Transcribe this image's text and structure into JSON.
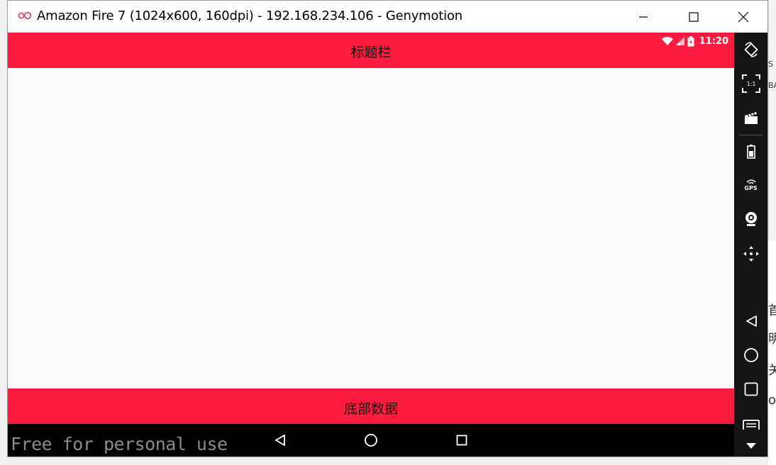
{
  "window": {
    "title": "Amazon Fire 7 (1024x600, 160dpi) - 192.168.234.106 - Genymotion"
  },
  "status_bar": {
    "time": "11:20"
  },
  "app": {
    "title": "标题栏",
    "bottom_text": "底部数据"
  },
  "watermark": "Free for personal use",
  "sidebar": {
    "items": [
      {
        "icon": "rotate-icon"
      },
      {
        "icon": "pixel-perfect-icon",
        "label": "1:1"
      },
      {
        "icon": "screencast-icon"
      },
      {
        "icon": "battery-icon"
      },
      {
        "icon": "gps-icon",
        "label": "GPS"
      },
      {
        "icon": "webcam-icon"
      },
      {
        "icon": "dpad-icon"
      },
      {
        "icon": "back-icon"
      },
      {
        "icon": "home-icon"
      },
      {
        "icon": "recents-icon"
      },
      {
        "icon": "menu-icon"
      },
      {
        "icon": "scroll-down-icon"
      }
    ]
  },
  "background_peek": [
    "S",
    "BA",
    "首",
    "明",
    "关",
    "o"
  ],
  "colors": {
    "accent": "#ff1a40",
    "sidebar": "#141414",
    "navbar": "#000000",
    "content": "#fafafa"
  }
}
